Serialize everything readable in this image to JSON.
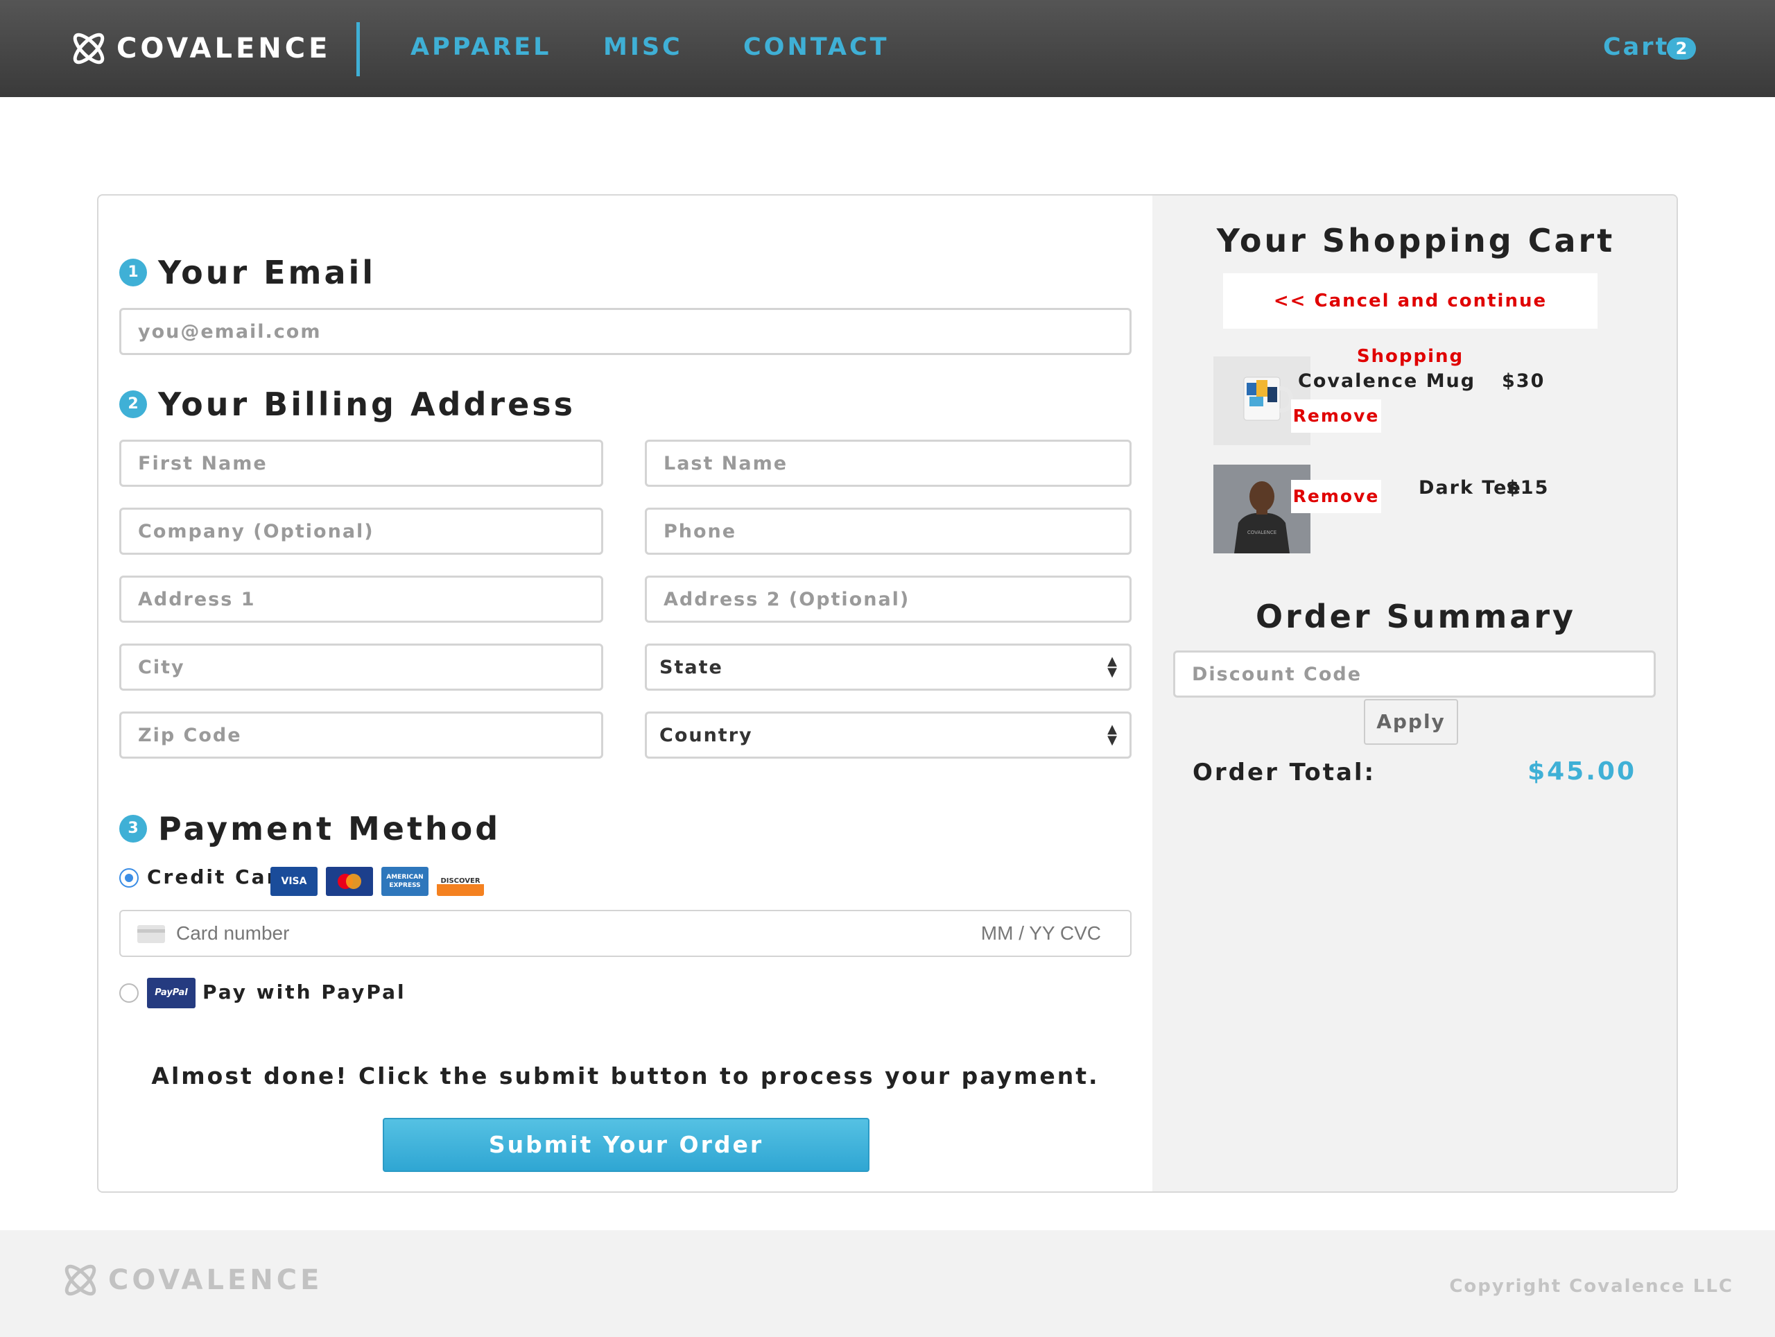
{
  "header": {
    "brand": "COVALENCE",
    "nav": [
      "APPAREL",
      "MISC",
      "CONTACT"
    ],
    "cart_label": "Cart",
    "cart_count": "2"
  },
  "checkout": {
    "email": {
      "number": "1",
      "title": "Your Email",
      "placeholder": "you@email.com"
    },
    "billing": {
      "number": "2",
      "title": "Your Billing Address",
      "first_name": "First Name",
      "last_name": "Last Name",
      "company": "Company (Optional)",
      "phone": "Phone",
      "address1": "Address 1",
      "address2": "Address 2 (Optional)",
      "city": "City",
      "state": "State",
      "zip": "Zip Code",
      "country": "Country"
    },
    "payment": {
      "number": "3",
      "title": "Payment Method",
      "credit_card_label": "Credit Card",
      "credit_card_selected": true,
      "card_brands": [
        "VISA",
        "MasterCard",
        "AMERICAN EXPRESS",
        "DISCOVER"
      ],
      "card_number_placeholder": "Card number",
      "card_exp_cvc_placeholder": "MM / YY  CVC",
      "paypal_label": "Pay with PayPal",
      "paypal_logo": "PayPal"
    },
    "almost_done": "Almost done! Click the submit button to process your payment.",
    "submit_label": "Submit Your Order"
  },
  "cart": {
    "title": "Your Shopping Cart",
    "cancel_label": "<< Cancel and continue Shopping",
    "items": [
      {
        "name": "Covalence Mug",
        "price": "$30",
        "remove": "Remove",
        "icon": "mug-thumbnail"
      },
      {
        "name": "Dark Tee",
        "price": "$15",
        "remove": "Remove",
        "icon": "tee-thumbnail"
      }
    ],
    "summary_title": "Order Summary",
    "discount_placeholder": "Discount Code",
    "apply_label": "Apply",
    "total_label": "Order Total:",
    "total_value": "$45.00"
  },
  "footer": {
    "brand": "COVALENCE",
    "copyright": "Copyright Covalence LLC"
  },
  "colors": {
    "accent": "#3fb0d6",
    "header_bg": "#444444",
    "remove_red": "#e00000",
    "panel_bg": "#f2f2f2"
  }
}
